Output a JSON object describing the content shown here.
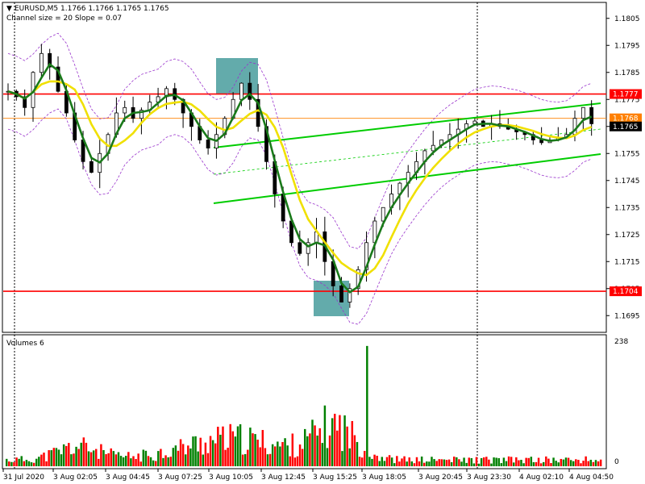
{
  "header": {
    "symbol": "EURUSD,M5",
    "ohlc": "1.1766 1.1766 1.1765 1.1765",
    "indicator": "Channel size = 20 Slope = 0.07",
    "volumes_label": "Volumes 6"
  },
  "colors": {
    "up_candle": "#000000",
    "volume_up": "#008000",
    "volume_down": "#ff0000",
    "ma_fast": "#1a7a1a",
    "ma_slow": "#f0e000",
    "channel": "#00cc00",
    "envelope": "#9933cc",
    "level": "#ff0000",
    "level2": "#ff8000",
    "highlight": "#2f8f8f"
  },
  "chart_data": {
    "type": "candlestick",
    "price_axis": {
      "ticks": [
        "1.1805",
        "1.1795",
        "1.1785",
        "1.1775",
        "1.1765",
        "1.1755",
        "1.1745",
        "1.1735",
        "1.1725",
        "1.1715",
        "1.1705",
        "1.1695"
      ],
      "ylim": [
        1.169,
        1.181
      ]
    },
    "time_axis": {
      "labels": [
        "31 Jul 2020",
        "3 Aug 02:05",
        "3 Aug 04:45",
        "3 Aug 07:25",
        "3 Aug 10:05",
        "3 Aug 12:45",
        "3 Aug 15:25",
        "3 Aug 18:05",
        "3 Aug 20:45",
        "3 Aug 23:30",
        "4 Aug 02:10",
        "4 Aug 04:50"
      ]
    },
    "levels": [
      {
        "price": 1.1777,
        "label": "1.1777",
        "color": "#ff0000"
      },
      {
        "price": 1.1704,
        "label": "1.1704",
        "color": "#ff0000"
      },
      {
        "price": 1.1768,
        "label": "1.1768",
        "color": "#ff8000"
      },
      {
        "price": 1.1765,
        "label": "1.1765",
        "color": "#000000"
      }
    ],
    "close_path": [
      1.1778,
      1.1776,
      1.1772,
      1.1785,
      1.1792,
      1.1787,
      1.1778,
      1.177,
      1.176,
      1.1752,
      1.1748,
      1.1755,
      1.1762,
      1.177,
      1.1772,
      1.1768,
      1.1771,
      1.1774,
      1.1776,
      1.1779,
      1.1775,
      1.177,
      1.1765,
      1.176,
      1.1757,
      1.1762,
      1.1768,
      1.1775,
      1.1781,
      1.1775,
      1.1765,
      1.1752,
      1.174,
      1.173,
      1.1722,
      1.1718,
      1.1722,
      1.1726,
      1.1715,
      1.1706,
      1.17,
      1.1705,
      1.1712,
      1.1722,
      1.173,
      1.1735,
      1.174,
      1.1744,
      1.1748,
      1.1752,
      1.1756,
      1.1758,
      1.176,
      1.1762,
      1.1764,
      1.1766,
      1.1767,
      1.1765,
      1.1766,
      1.1765,
      1.1764,
      1.1763,
      1.1762,
      1.176,
      1.1759,
      1.176,
      1.1761,
      1.1762,
      1.1768,
      1.1772,
      1.1766
    ],
    "volumes": {
      "ylim": [
        0,
        238
      ],
      "ticks": [
        "238",
        "0"
      ]
    }
  }
}
